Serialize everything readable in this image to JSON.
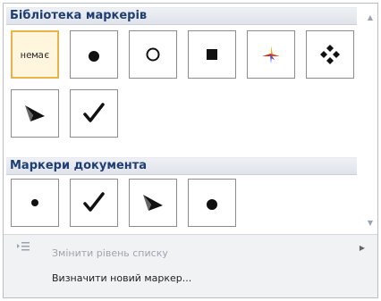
{
  "library": {
    "title": "Бібліотека маркерів",
    "items": [
      {
        "label": "немає",
        "icon": "none-text"
      },
      {
        "icon": "filled-circle-icon"
      },
      {
        "icon": "hollow-circle-icon"
      },
      {
        "icon": "filled-square-icon"
      },
      {
        "icon": "colorful-star-icon"
      },
      {
        "icon": "four-diamond-icon"
      },
      {
        "icon": "arrowhead-icon"
      },
      {
        "icon": "checkmark-icon"
      }
    ]
  },
  "document": {
    "title": "Маркери документа",
    "items": [
      {
        "icon": "small-dot-icon"
      },
      {
        "icon": "checkmark-icon"
      },
      {
        "icon": "arrowhead-icon"
      },
      {
        "icon": "filled-circle-icon"
      }
    ]
  },
  "footer": {
    "change_level": "Змінити рівень списку",
    "define_new": "Визначити новий маркер..."
  },
  "colors": {
    "header_text": "#1f3e73",
    "selected_border": "#e9b24a",
    "selected_fill": "#fff6dd"
  }
}
